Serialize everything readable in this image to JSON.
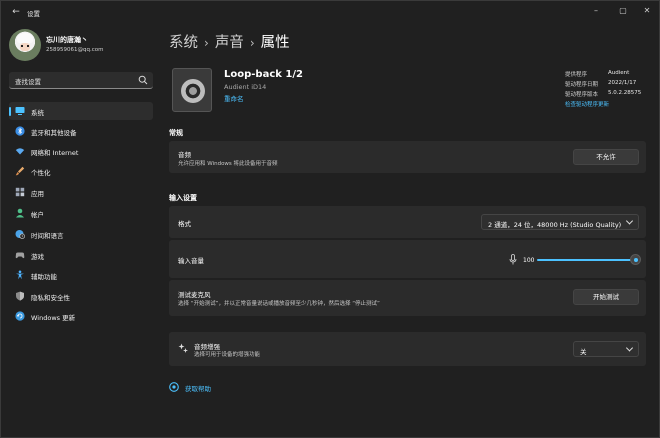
{
  "window": {
    "app_title": "设置",
    "back_glyph": "←",
    "controls": [
      "–",
      "▢",
      "✕"
    ]
  },
  "user": {
    "name": "忘川的唐瀚丶",
    "email": "258959061@qq.com"
  },
  "search": {
    "placeholder": "查找设置"
  },
  "sidebar": {
    "items": [
      {
        "label": "系统",
        "icon": "monitor-icon",
        "color": "#4cc2ff",
        "selected": true
      },
      {
        "label": "蓝牙和其他设备",
        "icon": "bluetooth-icon",
        "color": "#3a8ee6"
      },
      {
        "label": "网络和 Internet",
        "icon": "wifi-icon",
        "color": "#5aa9f0"
      },
      {
        "label": "个性化",
        "icon": "brush-icon",
        "color": "#e6a96b"
      },
      {
        "label": "应用",
        "icon": "apps-icon",
        "color": "#9fa8b8"
      },
      {
        "label": "帐户",
        "icon": "person-icon",
        "color": "#4fc08a"
      },
      {
        "label": "时间和语言",
        "icon": "globe-clock-icon",
        "color": "#4aa3e8"
      },
      {
        "label": "游戏",
        "icon": "gamepad-icon",
        "color": "#a0a0a0"
      },
      {
        "label": "辅助功能",
        "icon": "accessibility-icon",
        "color": "#4fb4ff"
      },
      {
        "label": "隐私和安全性",
        "icon": "shield-icon",
        "color": "#8b8b8b"
      },
      {
        "label": "Windows 更新",
        "icon": "update-icon",
        "color": "#3b9ae0"
      }
    ]
  },
  "breadcrumb": {
    "items": [
      "系统",
      "声音",
      "属性"
    ],
    "separator": "›"
  },
  "device": {
    "name": "Loop-back 1/2",
    "subtitle": "Audient iD14",
    "rename": "重命名"
  },
  "driver": {
    "rows": [
      {
        "label": "提供程序",
        "value": "Audient"
      },
      {
        "label": "驱动程序日期",
        "value": "2022/1/17"
      },
      {
        "label": "驱动程序版本",
        "value": "5.0.2.28575"
      }
    ],
    "check_update": "检查驱动程序更新"
  },
  "general": {
    "section_title": "常规",
    "audio": {
      "title": "音频",
      "desc": "允许应用和 Windows 将此设备用于音频",
      "button": "不允许"
    }
  },
  "input_settings": {
    "section_title": "输入设置",
    "format": {
      "title": "格式",
      "value": "2 通道，24 位，48000 Hz (Studio Quality)"
    },
    "volume": {
      "title": "输入音量",
      "value": "100",
      "level_percent": 100
    },
    "test_mic": {
      "title": "测试麦克风",
      "desc": "选择 “开始测试”，并以正常音量说话或播放音频至少几秒钟，然后选择 “停止测试”",
      "button": "开始测试"
    }
  },
  "enhancement": {
    "title": "音频增强",
    "desc": "选择可用于设备的增强功能",
    "value": "关"
  },
  "help": {
    "label": "获取帮助"
  }
}
